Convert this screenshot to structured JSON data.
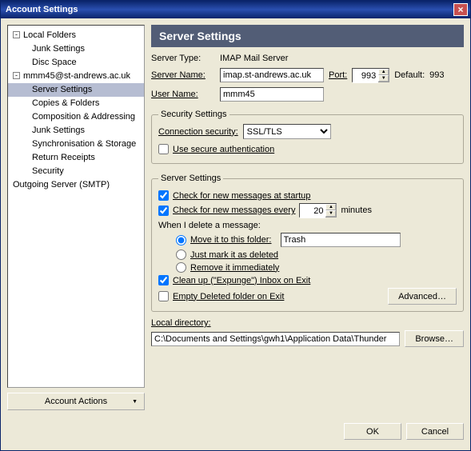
{
  "window": {
    "title": "Account Settings",
    "close_icon": "×"
  },
  "sidebar": {
    "items": [
      {
        "label": "Local Folders",
        "level": 0,
        "expanded": true
      },
      {
        "label": "Junk Settings",
        "level": 1
      },
      {
        "label": "Disc Space",
        "level": 1
      },
      {
        "label": "mmm45@st-andrews.ac.uk",
        "level": 0,
        "expanded": true
      },
      {
        "label": "Server Settings",
        "level": 1,
        "selected": true
      },
      {
        "label": "Copies & Folders",
        "level": 1
      },
      {
        "label": "Composition & Addressing",
        "level": 1
      },
      {
        "label": "Junk Settings",
        "level": 1
      },
      {
        "label": "Synchronisation & Storage",
        "level": 1
      },
      {
        "label": "Return Receipts",
        "level": 1
      },
      {
        "label": "Security",
        "level": 1
      },
      {
        "label": "Outgoing Server (SMTP)",
        "level": 0,
        "leaf": true
      }
    ],
    "account_actions": "Account Actions"
  },
  "main": {
    "header": "Server Settings",
    "server_type_label": "Server Type:",
    "server_type_value": "IMAP Mail Server",
    "server_name_label": "Server Name:",
    "server_name_value": "imap.st-andrews.ac.uk",
    "port_label": "Port:",
    "port_value": "993",
    "default_label": "Default:",
    "default_value": "993",
    "user_name_label": "User Name:",
    "user_name_value": "mmm45",
    "security_legend": "Security Settings",
    "conn_sec_label": "Connection security:",
    "conn_sec_value": "SSL/TLS",
    "use_secure_auth": "Use secure authentication",
    "server_legend": "Server Settings",
    "check_startup": "Check for new messages at startup",
    "check_every_pre": "Check for new messages every",
    "check_every_val": "20",
    "check_every_post": "minutes",
    "when_delete": "When I delete a message:",
    "move_folder": "Move it to this folder:",
    "trash_value": "Trash",
    "just_mark": "Just mark it as deleted",
    "remove_immediately": "Remove it immediately",
    "expunge": "Clean up (\"Expunge\") Inbox on Exit",
    "empty_deleted": "Empty Deleted folder on Exit",
    "advanced": "Advanced…",
    "local_dir_label": "Local directory:",
    "local_dir_value": "C:\\Documents and Settings\\gwh1\\Application Data\\Thunder",
    "browse": "Browse…"
  },
  "buttons": {
    "ok": "OK",
    "cancel": "Cancel"
  }
}
